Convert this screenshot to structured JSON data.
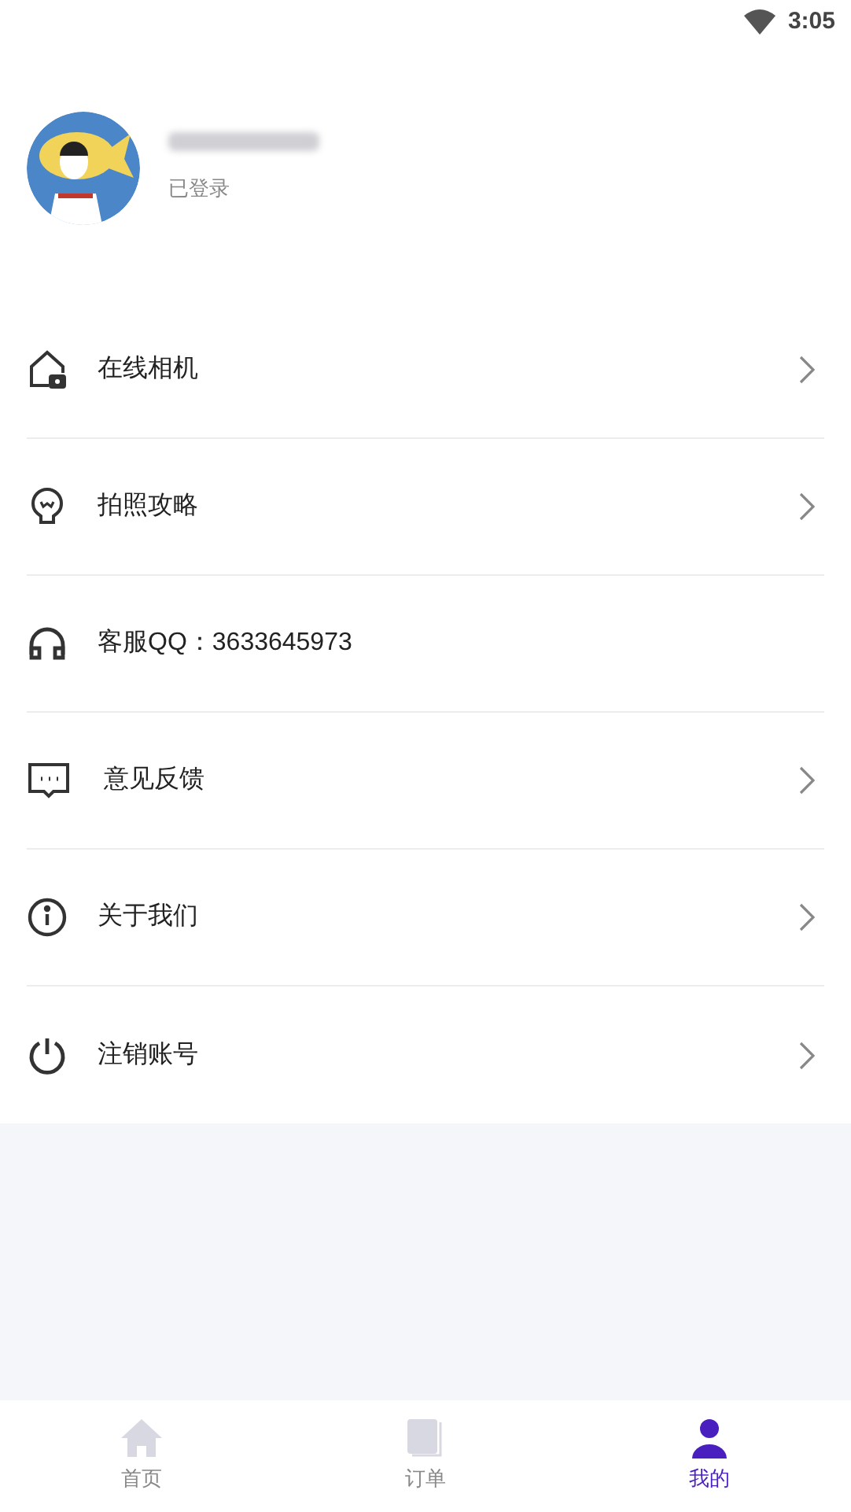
{
  "status_bar": {
    "time": "3:05"
  },
  "profile": {
    "status": "已登录"
  },
  "menu": [
    {
      "label": "在线相机",
      "arrow": true
    },
    {
      "label": "拍照攻略",
      "arrow": true
    },
    {
      "label": "客服QQ：3633645973",
      "arrow": false
    },
    {
      "label": "意见反馈",
      "arrow": true
    },
    {
      "label": "关于我们",
      "arrow": true
    },
    {
      "label": "注销账号",
      "arrow": true
    }
  ],
  "tabs": [
    {
      "label": "首页",
      "selected": false
    },
    {
      "label": "订单",
      "selected": false
    },
    {
      "label": "我的",
      "selected": true
    }
  ]
}
